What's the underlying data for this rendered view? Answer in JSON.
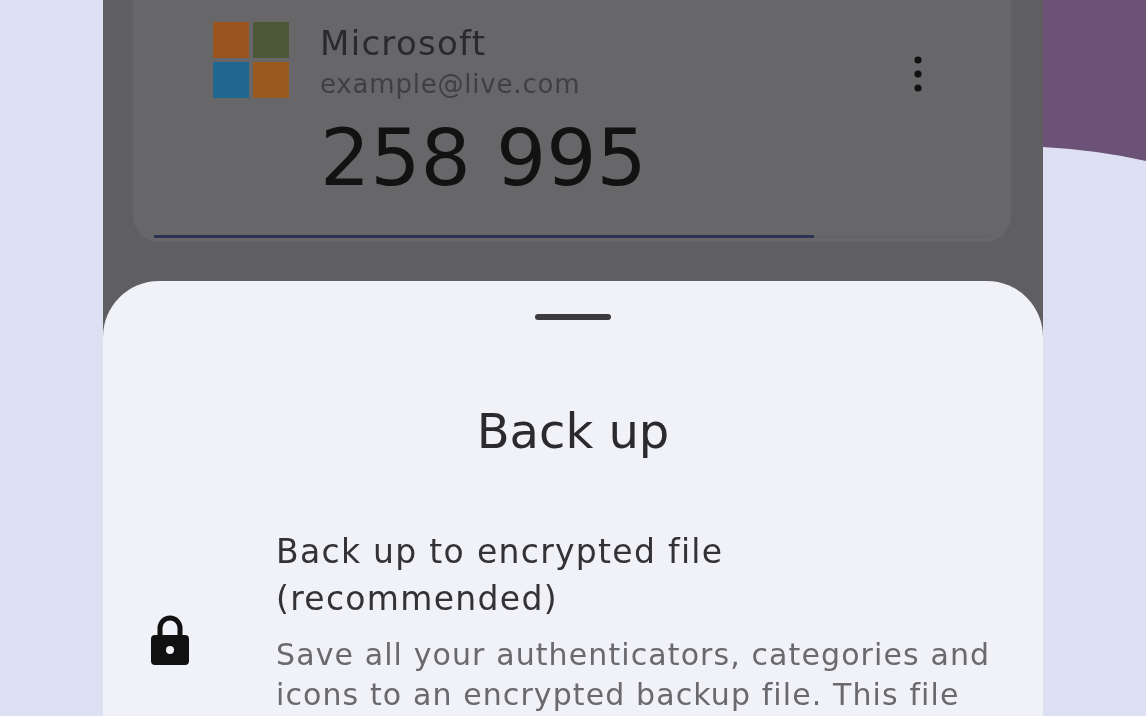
{
  "account": {
    "issuer": "Microsoft",
    "username": "example@live.com",
    "code": "258 995",
    "timer": {
      "level": 0.79
    }
  },
  "bottom_sheet": {
    "title": "Back up",
    "options": [
      {
        "title": "Back up to encrypted file (recommended)",
        "description": "Save all your authenticators, categories and icons to an encrypted backup file. This file"
      }
    ]
  }
}
